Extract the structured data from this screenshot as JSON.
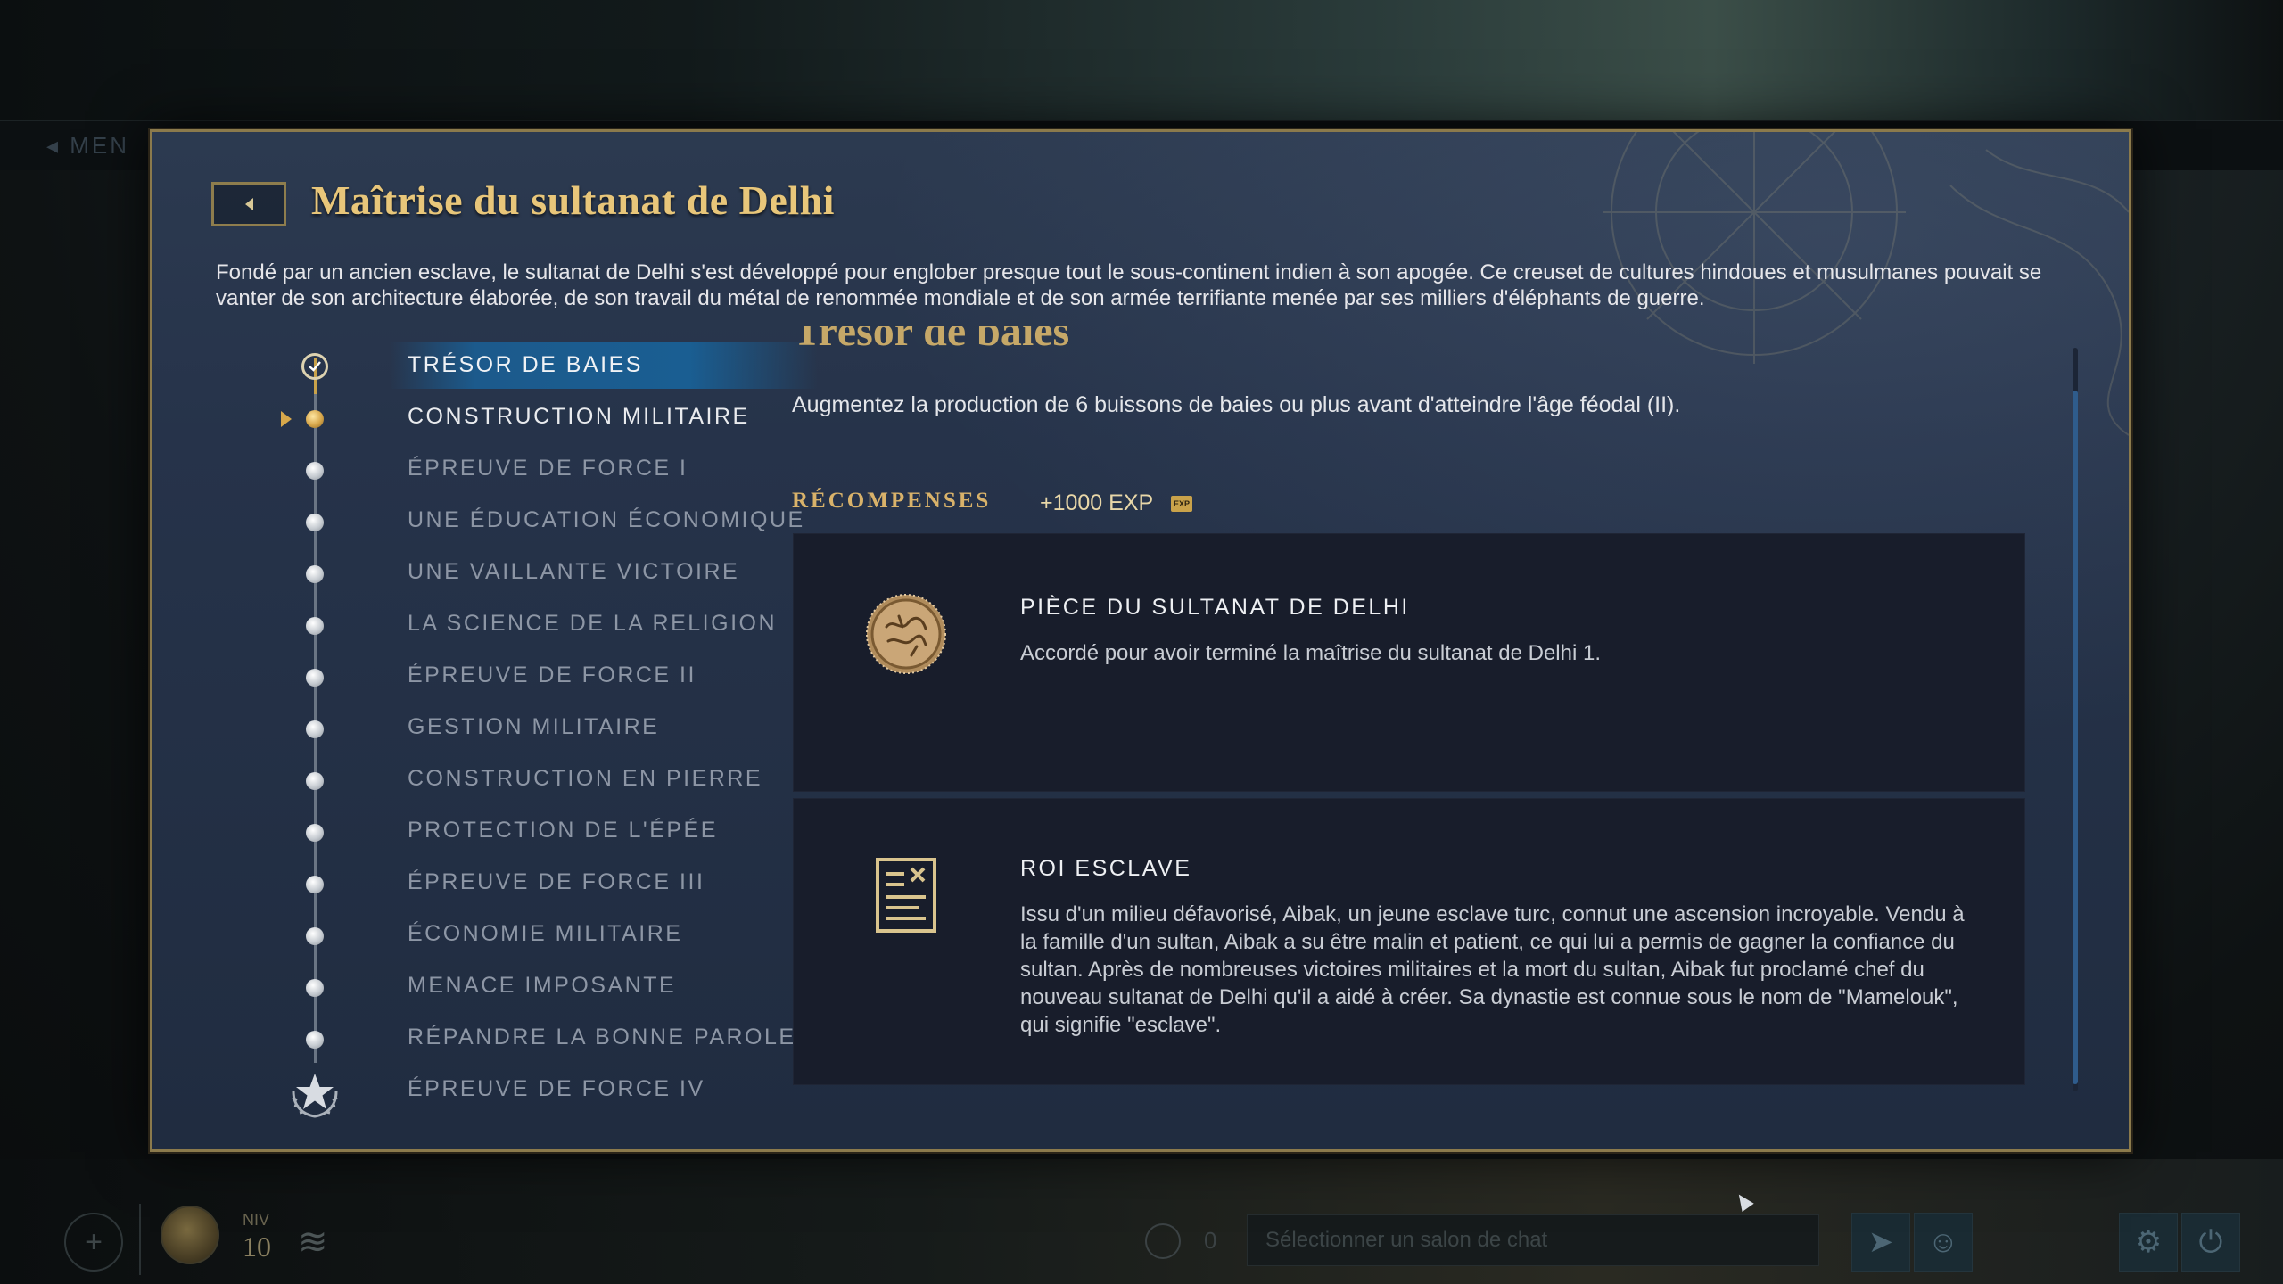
{
  "background": {
    "top_strip_ghost": "◂ MEN",
    "hud": {
      "level_label": "NIV",
      "level_value": "10",
      "chat_count": "0",
      "chat_placeholder": "Sélectionner un salon de chat"
    }
  },
  "dialog": {
    "title": "Maîtrise du sultanat de Delhi",
    "description": "Fondé par un ancien esclave, le sultanat de Delhi s'est développé pour englober presque tout le sous-continent indien à son apogée. Ce creuset de cultures hindoues et musulmanes pouvait se vanter de son architecture élaborée, de son travail du métal de renommée mondiale et de son armée terrifiante menée par ses milliers d'éléphants de guerre."
  },
  "achievements": [
    {
      "label": "TRÉSOR DE BAIES",
      "state": "completed"
    },
    {
      "label": "CONSTRUCTION MILITAIRE",
      "state": "current"
    },
    {
      "label": "ÉPREUVE DE FORCE I",
      "state": "locked"
    },
    {
      "label": "UNE ÉDUCATION ÉCONOMIQUE",
      "state": "locked"
    },
    {
      "label": "UNE VAILLANTE VICTOIRE",
      "state": "locked"
    },
    {
      "label": "LA SCIENCE DE LA RELIGION",
      "state": "locked"
    },
    {
      "label": "ÉPREUVE DE FORCE II",
      "state": "locked"
    },
    {
      "label": "GESTION MILITAIRE",
      "state": "locked"
    },
    {
      "label": "CONSTRUCTION EN PIERRE",
      "state": "locked"
    },
    {
      "label": "PROTECTION DE L'ÉPÉE",
      "state": "locked"
    },
    {
      "label": "ÉPREUVE DE FORCE III",
      "state": "locked"
    },
    {
      "label": "ÉCONOMIE MILITAIRE",
      "state": "locked"
    },
    {
      "label": "MENACE IMPOSANTE",
      "state": "locked"
    },
    {
      "label": "RÉPANDRE LA BONNE PAROLE",
      "state": "locked"
    },
    {
      "label": "ÉPREUVE DE FORCE IV",
      "state": "final"
    }
  ],
  "objective": {
    "title": "Trésor de baies",
    "description": "Augmentez la production de 6 buissons de baies ou plus avant d'atteindre l'âge féodal (II)."
  },
  "rewards": {
    "label": "RÉCOMPENSES",
    "exp": "+1000 EXP",
    "exp_icon_text": "EXP",
    "items": [
      {
        "title": "PIÈCE DU SULTANAT DE DELHI",
        "description": "Accordé pour avoir terminé la maîtrise du sultanat de Delhi 1.",
        "icon": "coin-icon"
      },
      {
        "title": "ROI ESCLAVE",
        "description": "Issu d'un milieu défavorisé, Aibak, un jeune esclave turc, connut une ascension incroyable. Vendu à la famille d'un sultan, Aibak a su être malin et patient, ce qui lui a permis de gagner la confiance du sultan. Après de nombreuses victoires militaires et la mort du sultan, Aibak fut proclamé chef du nouveau sultanat de Delhi qu'il a aidé à créer. Sa dynastie est connue sous le nom de \"Mamelouk\", qui signifie \"esclave\".",
        "icon": "scroll-document-icon"
      }
    ]
  },
  "colors": {
    "accent_gold": "#e8c67a",
    "selection_blue": "#1a5e92",
    "panel_bg": "#26334a",
    "card_bg": "#181d2b"
  }
}
